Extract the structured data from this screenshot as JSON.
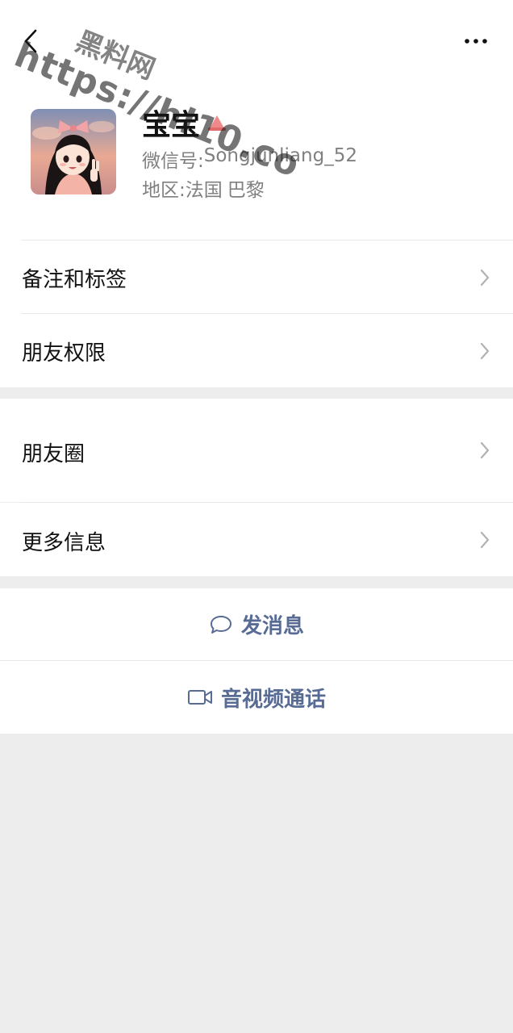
{
  "header": {
    "back_icon": "chevron-left-icon",
    "more_icon": "more-horizontal-icon"
  },
  "watermark": {
    "line1": "黑料网",
    "line2": "https://hl10.co"
  },
  "profile": {
    "name": "宝宝",
    "wechat_id_label": "微信号:",
    "wechat_id": "Songjunliang_52",
    "region_label": "地区:",
    "region_country": "法国",
    "region_city": "巴黎"
  },
  "menu": {
    "remarks": "备注和标签",
    "permissions": "朋友权限",
    "moments": "朋友圈",
    "more_info": "更多信息"
  },
  "actions": {
    "message": "发消息",
    "video_call": "音视频通话"
  },
  "colors": {
    "link_blue": "#576b95",
    "background": "#ededed"
  }
}
